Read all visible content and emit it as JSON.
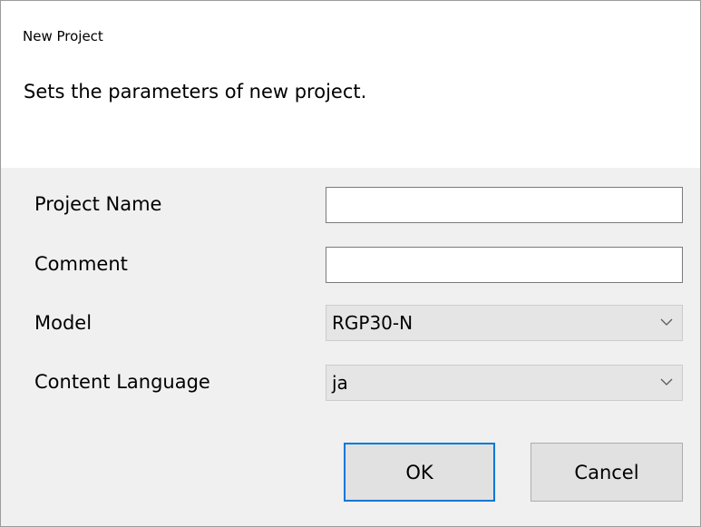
{
  "window": {
    "title": "New Project"
  },
  "header": {
    "description": "Sets the parameters of new project."
  },
  "form": {
    "project_name": {
      "label": "Project Name",
      "value": ""
    },
    "comment": {
      "label": "Comment",
      "value": ""
    },
    "model": {
      "label": "Model",
      "selected": "RGP30-N",
      "icon": "chevron-down-icon"
    },
    "content_language": {
      "label": "Content  Language",
      "selected": "ja",
      "icon": "chevron-down-icon"
    }
  },
  "buttons": {
    "ok_label": "OK",
    "cancel_label": "Cancel"
  },
  "colors": {
    "header_bg": "#ffffff",
    "body_bg": "#f0f0f0",
    "focus_border": "#0078d7",
    "button_bg": "#e1e1e1"
  }
}
